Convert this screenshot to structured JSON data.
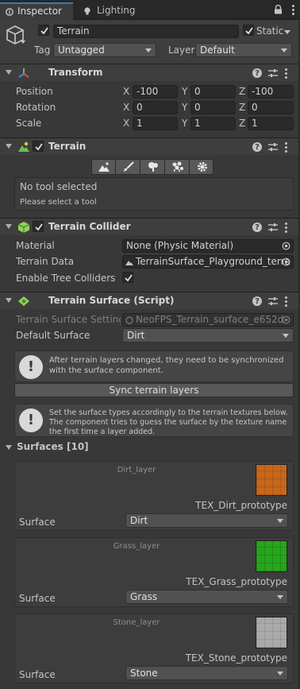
{
  "tabs": {
    "inspector": "Inspector",
    "lighting": "Lighting"
  },
  "object": {
    "name": "Terrain",
    "static_label": "Static",
    "tag_label": "Tag",
    "tag_value": "Untagged",
    "layer_label": "Layer",
    "layer_value": "Default"
  },
  "transform": {
    "title": "Transform",
    "position_label": "Position",
    "rotation_label": "Rotation",
    "scale_label": "Scale",
    "axis_x": "X",
    "axis_y": "Y",
    "axis_z": "Z",
    "position": {
      "x": "-100",
      "y": "0",
      "z": "-100"
    },
    "rotation": {
      "x": "0",
      "y": "0",
      "z": "0"
    },
    "scale": {
      "x": "1",
      "y": "1",
      "z": "1"
    }
  },
  "terrain": {
    "title": "Terrain",
    "tools": [
      "raise-lower-icon",
      "paint-brush-icon",
      "tree-icon",
      "details-icon",
      "settings-gear-icon"
    ],
    "status_title": "No tool selected",
    "status_hint": "Please select a tool"
  },
  "collider": {
    "title": "Terrain Collider",
    "material_label": "Material",
    "material_value": "None (Physic Material)",
    "terrain_data_label": "Terrain Data",
    "terrain_data_value": "TerrainSurface_Playground_terra",
    "tree_colliders_label": "Enable Tree Colliders"
  },
  "surface_script": {
    "title": "Terrain Surface (Script)",
    "settings_label": "Terrain Surface Settings",
    "settings_value": "NeoFPS_Terrain_surface_e652d",
    "default_surface_label": "Default Surface",
    "default_surface_value": "Dirt",
    "info1_line1": "After terrain layers changed, they need to be synchronized",
    "info1_line2": "with the surface component.",
    "sync_button": "Sync terrain layers",
    "info2_line1": "Set the surface types accordingly to the terrain textures below.",
    "info2_line2": "The component tries to guess the surface by the texture name",
    "info2_line3": "the first time a layer added.",
    "surfaces_header": "Surfaces [10]",
    "surface_label": "Surface",
    "surfaces": [
      {
        "layer": "Dirt_layer",
        "texture": "TEX_Dirt_prototype",
        "surface": "Dirt",
        "color": "#c8661a"
      },
      {
        "layer": "Grass_layer",
        "texture": "TEX_Grass_prototype",
        "surface": "Grass",
        "color": "#26a61c"
      },
      {
        "layer": "Stone_layer",
        "texture": "TEX_Stone_prototype",
        "surface": "Stone",
        "color": "#a9a9a9"
      }
    ]
  },
  "colors": {
    "accent": "#3a79bb",
    "background": "#383838",
    "header": "#3e3e3e",
    "field": "#2a2a2a"
  }
}
